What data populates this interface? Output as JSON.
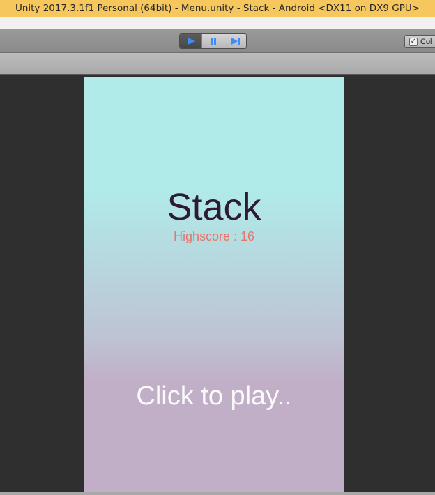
{
  "window": {
    "title": "Unity 2017.3.1f1 Personal (64bit) - Menu.unity - Stack - Android <DX11 on DX9 GPU>"
  },
  "toolbar": {
    "play_icon": "play-icon",
    "pause_icon": "pause-icon",
    "step_icon": "step-icon",
    "collab_label": "Col"
  },
  "game": {
    "title": "Stack",
    "highscore": "Highscore : 16",
    "prompt": "Click to play..",
    "colors": {
      "top": "#b0ebe9",
      "bottom": "#c1aec7",
      "title": "#2e1a33",
      "highscore": "#e9746a",
      "prompt": "#fbfbfb"
    }
  }
}
